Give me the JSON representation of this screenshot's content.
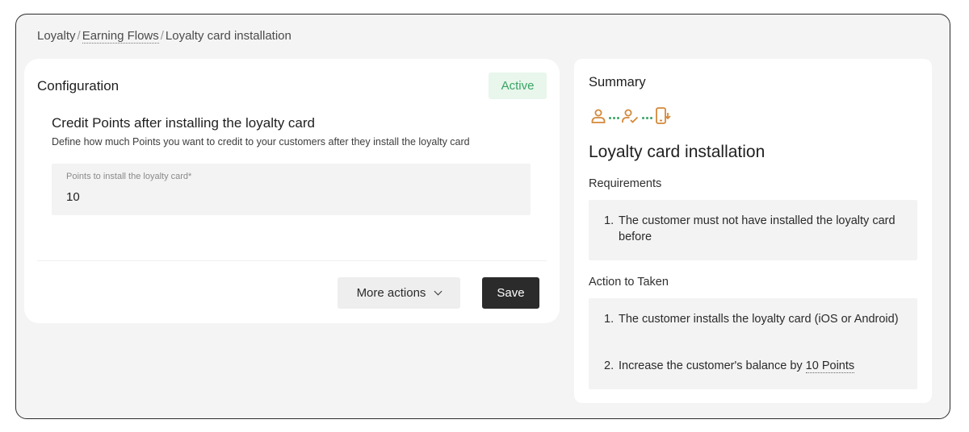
{
  "breadcrumb": {
    "root": "Loyalty",
    "separator": "/",
    "middle": "Earning Flows",
    "current": "Loyalty card installation"
  },
  "config": {
    "title": "Configuration",
    "status": "Active",
    "section_title": "Credit Points after installing the loyalty card",
    "section_desc": "Define how much Points you want to credit to your customers after they install the loyalty card",
    "input_label": "Points to install the loyalty card*",
    "input_value": "10",
    "more_actions_label": "More actions",
    "save_label": "Save"
  },
  "summary": {
    "title": "Summary",
    "flow_icons": [
      "user-icon",
      "user-check-icon",
      "phone-download-icon"
    ],
    "flow_name": "Loyalty card installation",
    "requirements_label": "Requirements",
    "requirements": [
      {
        "num": "1.",
        "text": "The customer must not have installed the loyalty card before"
      }
    ],
    "action_label": "Action to Taken",
    "actions": [
      {
        "num": "1.",
        "text": "The customer installs the loyalty card (iOS or Android)"
      },
      {
        "num": "2.",
        "text_prefix": "Increase the customer's balance by ",
        "text_link": "10 Points"
      }
    ]
  },
  "colors": {
    "accent_orange": "#d4883a",
    "active_green": "#3aa463",
    "active_bg": "#e8f6ec",
    "save_bg": "#2b2b2b"
  }
}
